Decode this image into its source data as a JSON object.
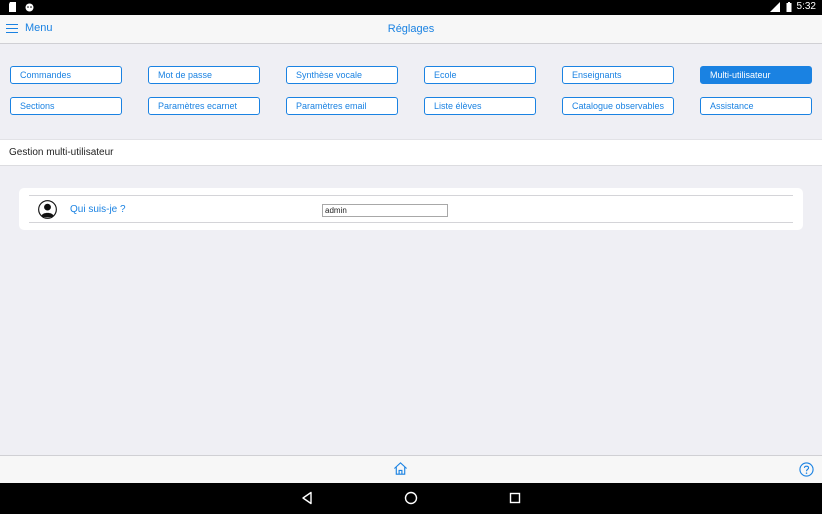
{
  "status_bar": {
    "time": "5:32"
  },
  "header": {
    "menu_label": "Menu",
    "title": "Réglages"
  },
  "tabs": [
    {
      "label": "Commandes"
    },
    {
      "label": "Mot de passe"
    },
    {
      "label": "Synthèse vocale"
    },
    {
      "label": "Ecole"
    },
    {
      "label": "Enseignants"
    },
    {
      "label": "Multi-utilisateur"
    },
    {
      "label": "Sections"
    },
    {
      "label": "Paramètres ecarnet"
    },
    {
      "label": "Paramètres email"
    },
    {
      "label": "Liste élèves"
    },
    {
      "label": "Catalogue observables"
    },
    {
      "label": "Assistance"
    }
  ],
  "active_tab": "Multi-utilisateur",
  "section": {
    "title": "Gestion multi-utilisateur"
  },
  "form": {
    "who_label": "Qui suis-je ?",
    "who_value": "admin"
  },
  "colors": {
    "accent": "#1a82e2",
    "background": "#efeff4"
  },
  "icons": {
    "home": "home-icon",
    "help": "help-icon",
    "avatar": "user-avatar-icon"
  }
}
